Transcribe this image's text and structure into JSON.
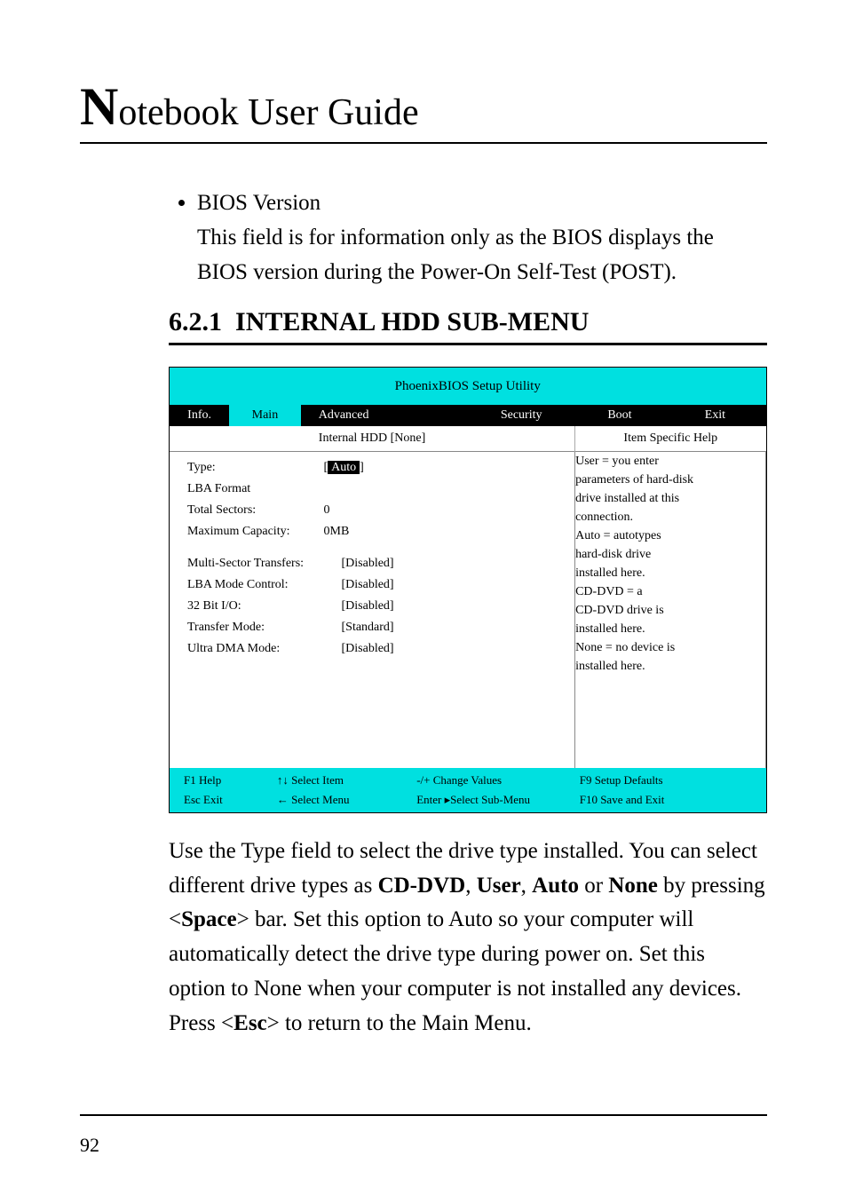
{
  "header": {
    "cap": "N",
    "rest": "otebook User Guide"
  },
  "bullet": {
    "title": "BIOS Version",
    "body": "This field is for information only as the BIOS displays the BIOS version during the Power-On Self-Test (POST)."
  },
  "section": {
    "num": "6.2.1",
    "title_sc1": "I",
    "title_rest1": "NTERNAL ",
    "title_sc2": "HDD S",
    "title_rest2": "UB",
    "title_dash": "-M",
    "title_rest3": "ENU"
  },
  "bios": {
    "top_title": "PhoenixBIOS Setup Utility",
    "menu": [
      "Info.",
      "Main",
      "Advanced",
      "Security",
      "Boot",
      "Exit"
    ],
    "menu_active_index": 1,
    "sub_left": "Internal HDD [None]",
    "sub_right": "Item Specific Help",
    "type_label": "Type:",
    "type_value": "Auto",
    "lba_label": "LBA Format",
    "total_label": "Total Sectors:",
    "total_value": "0",
    "max_label": "Maximum Capacity:",
    "max_value": "0MB",
    "multi_label": "Multi-Sector Transfers:",
    "multi_value": "[Disabled]",
    "lba_mode_label": "LBA Mode Control:",
    "lba_mode_value": "[Disabled]",
    "pio_label": "32 Bit I/O:",
    "pio_value": "[Disabled]",
    "transfer_label": "Transfer Mode:",
    "transfer_value": "[Standard]",
    "udma_label": "Ultra DMA Mode:",
    "udma_value": "[Disabled]",
    "help_lines": [
      "User = you enter",
      "parameters of hard-disk",
      "drive installed at this",
      "connection.",
      "Auto = autotypes",
      "hard-disk drive",
      "installed here.",
      "CD-DVD = a",
      "CD-DVD drive is",
      "installed here.",
      "None = no device is",
      "installed here."
    ],
    "footer": {
      "f1": "F1   Help",
      "updown": "  Select Item",
      "minusplus": "-/+  Change Values",
      "f9": "F9   Setup Defaults",
      "esc": "Esc  Exit",
      "leftright": "  Select Menu",
      "enter": "Enter",
      "select_sub": "Select   Sub-Menu",
      "f10": "F10  Save and Exit"
    }
  },
  "para": {
    "t1": "Use the Type field to select the drive type installed. You can select different drive types as ",
    "b1": "CD-DVD",
    "c1": ", ",
    "b2": "User",
    "c2": ", ",
    "b3": "Auto",
    "c3": " or ",
    "b4": "None",
    "c4": " by pressing <",
    "b5": "Space",
    "c5": "> bar. Set this option to Auto so your computer will automatically detect the drive type during power on. Set this option to None when your computer is not installed any devices. Press <",
    "b6": "Esc",
    "c6": "> to return to the Main Menu."
  },
  "page_num": "92"
}
